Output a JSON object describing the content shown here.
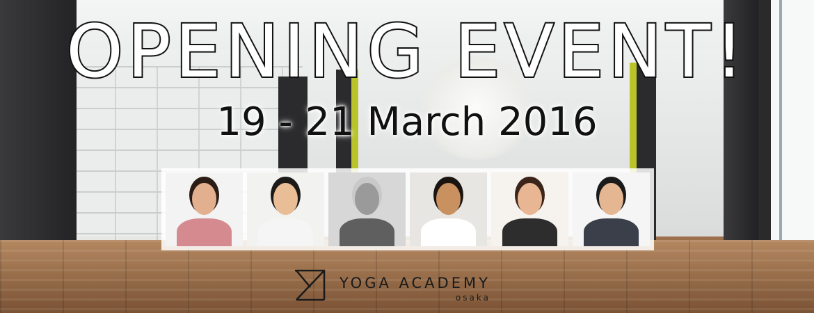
{
  "banner": {
    "headline": "OPENING EVENT!",
    "date": "19 - 21 March 2016"
  },
  "photos": [
    {
      "name": "instructor-1",
      "bg": "#f3f3f3",
      "skin": "#e2b08f",
      "hair": "#2b1d15",
      "cloth": "#d48a8f"
    },
    {
      "name": "instructor-2",
      "bg": "#f2f2f0",
      "skin": "#e9bd96",
      "hair": "#1c1a18",
      "cloth": "#f5f5f5"
    },
    {
      "name": "instructor-3",
      "bg": "#d7d7d7",
      "skin": "#9a9a9a",
      "hair": "#c9c9c9",
      "cloth": "#5f5f5f"
    },
    {
      "name": "instructor-4",
      "bg": "#e8e6e3",
      "skin": "#c9915f",
      "hair": "#1a1410",
      "cloth": "#ffffff"
    },
    {
      "name": "instructor-5",
      "bg": "#f6f2ee",
      "skin": "#e9b694",
      "hair": "#3b241a",
      "cloth": "#2d2d2d"
    },
    {
      "name": "instructor-6",
      "bg": "#f5f5f5",
      "skin": "#e5b692",
      "hair": "#1a1a1a",
      "cloth": "#3a3f4a"
    }
  ],
  "logo": {
    "name": "YOGA ACADEMY",
    "sub": "osaka",
    "icon": "ya-logo-icon"
  }
}
